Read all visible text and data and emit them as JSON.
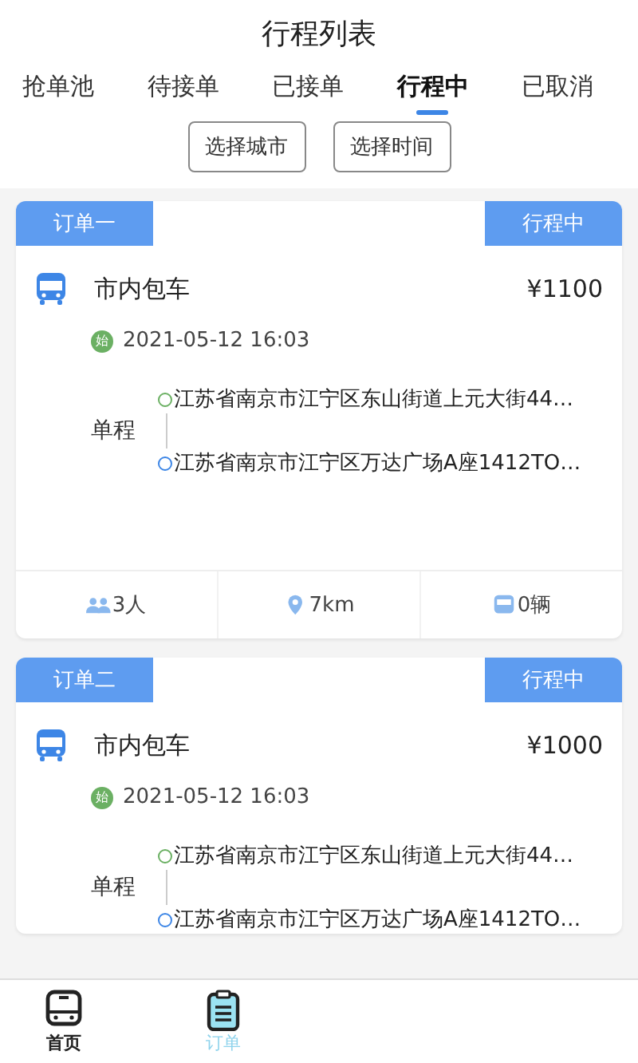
{
  "header": {
    "title": "行程列表"
  },
  "tabs": [
    {
      "label": "抢单池",
      "selected": false
    },
    {
      "label": "待接单",
      "selected": false
    },
    {
      "label": "已接单",
      "selected": false
    },
    {
      "label": "行程中",
      "selected": true
    },
    {
      "label": "已取消",
      "selected": false
    }
  ],
  "filters": [
    "选择城市",
    "选择时间"
  ],
  "orders": [
    {
      "name": "订单一",
      "status": "行程中",
      "service": "市内包车",
      "price": "¥1100",
      "start_badge": "始",
      "time": "2021-05-12 16:03",
      "trip_type": "单程",
      "from": "江苏省南京市江宁区东山街道上元大街44…",
      "to": "江苏省南京市江宁区万达广场A座1412TO…",
      "stats": [
        {
          "kind": "people",
          "text": "3人"
        },
        {
          "kind": "distance",
          "text": "7km"
        },
        {
          "kind": "vehicles",
          "text": "0辆"
        }
      ]
    },
    {
      "name": "订单二",
      "status": "行程中",
      "service": "市内包车",
      "price": "¥1000",
      "start_badge": "始",
      "time": "2021-05-12 16:03",
      "trip_type": "单程",
      "from": "江苏省南京市江宁区东山街道上元大街44…",
      "to": "江苏省南京市江宁区万达广场A座1412TO…"
    }
  ],
  "bottom_nav": [
    {
      "kind": "home",
      "label": "首页",
      "selected": false
    },
    {
      "kind": "orders",
      "label": "订单",
      "selected": true
    }
  ]
}
